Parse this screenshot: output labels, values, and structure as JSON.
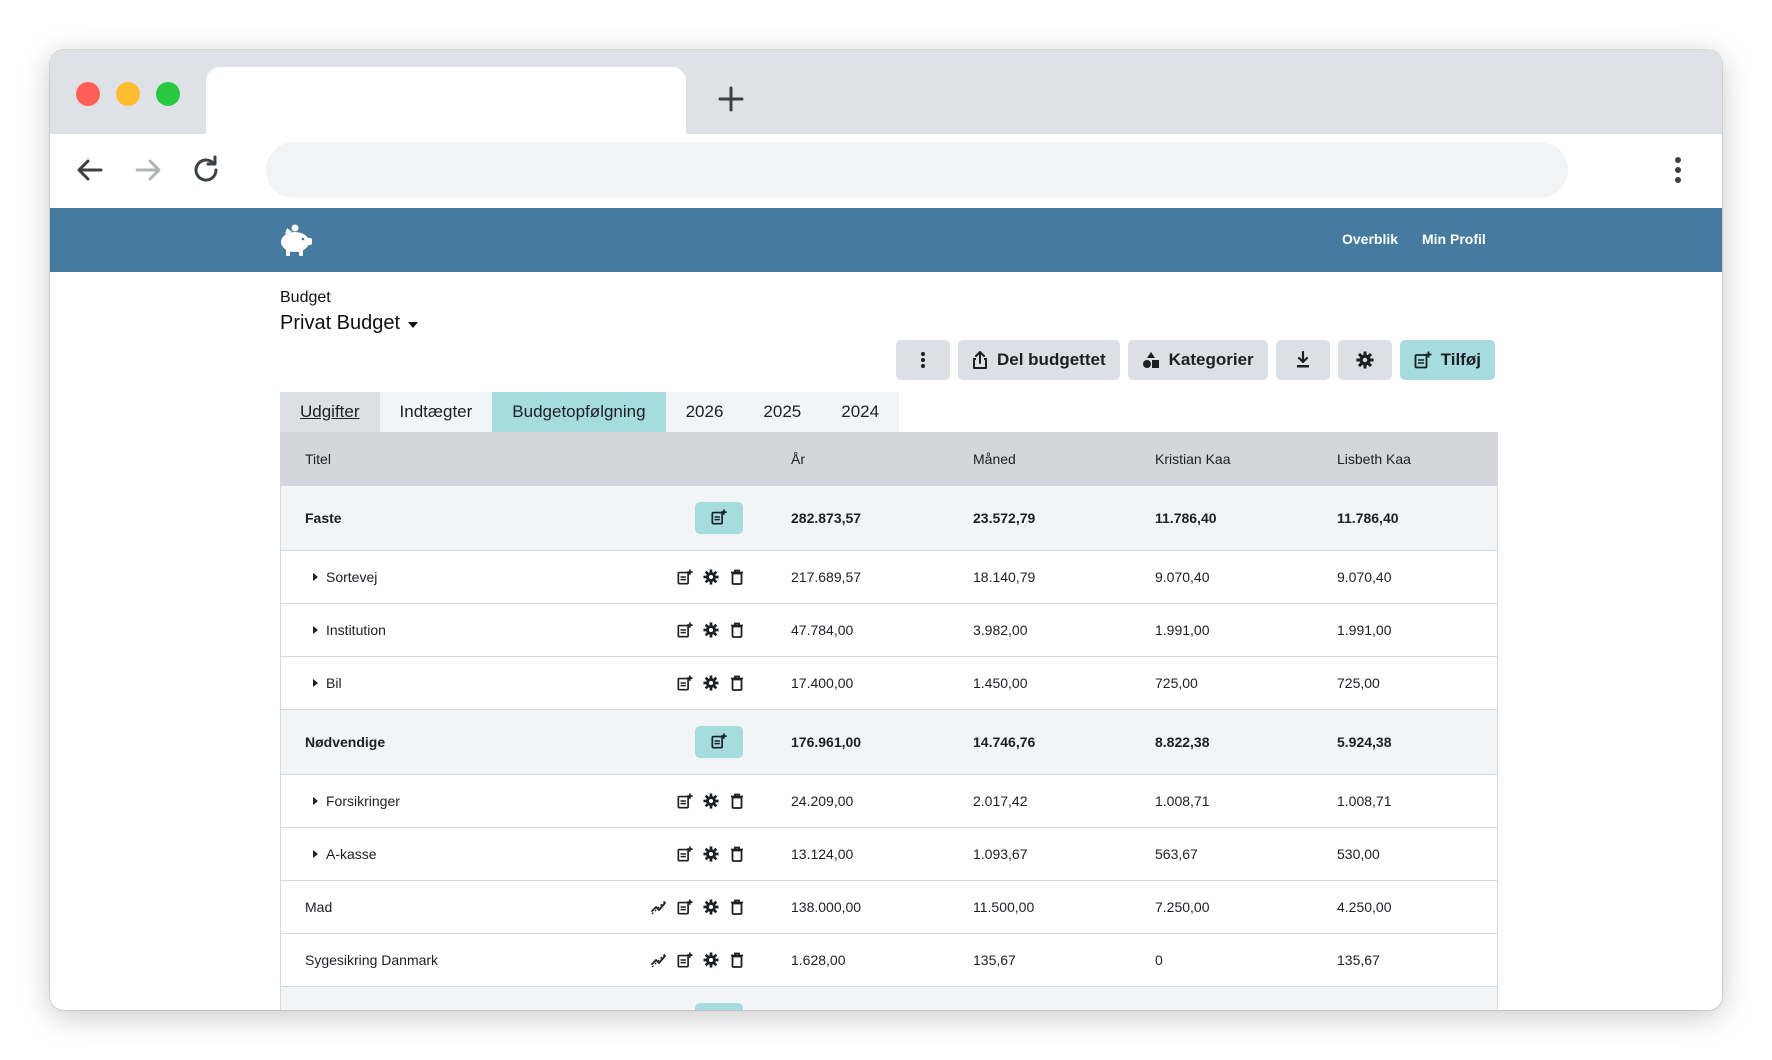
{
  "nav": {
    "links": [
      {
        "label": "Overblik"
      },
      {
        "label": "Min Profil"
      }
    ]
  },
  "budget": {
    "label": "Budget",
    "selected": "Privat Budget"
  },
  "actions": {
    "more": "more-vertical-icon",
    "share_label": "Del budgettet",
    "categories_label": "Kategorier",
    "download": "download-icon",
    "settings": "gear-icon",
    "add_label": "Tilføj"
  },
  "tabs": [
    {
      "label": "Udgifter"
    },
    {
      "label": "Indtægter"
    },
    {
      "label": "Budgetopfølgning"
    },
    {
      "label": "2026"
    },
    {
      "label": "2025"
    },
    {
      "label": "2024"
    }
  ],
  "table": {
    "headers": [
      "Titel",
      "År",
      "Måned",
      "Kristian Kaa",
      "Lisbeth Kaa"
    ],
    "rows": [
      {
        "kind": "group",
        "title": "Faste",
        "ar": "282.873,57",
        "maned": "23.572,79",
        "kristian": "11.786,40",
        "lisbeth": "11.786,40"
      },
      {
        "kind": "sub",
        "title": "Sortevej",
        "ar": "217.689,57",
        "maned": "18.140,79",
        "kristian": "9.070,40",
        "lisbeth": "9.070,40"
      },
      {
        "kind": "sub",
        "title": "Institution",
        "ar": "47.784,00",
        "maned": "3.982,00",
        "kristian": "1.991,00",
        "lisbeth": "1.991,00"
      },
      {
        "kind": "sub",
        "title": "Bil",
        "ar": "17.400,00",
        "maned": "1.450,00",
        "kristian": "725,00",
        "lisbeth": "725,00"
      },
      {
        "kind": "group",
        "title": "Nødvendige",
        "ar": "176.961,00",
        "maned": "14.746,76",
        "kristian": "8.822,38",
        "lisbeth": "5.924,38"
      },
      {
        "kind": "sub",
        "title": "Forsikringer",
        "ar": "24.209,00",
        "maned": "2.017,42",
        "kristian": "1.008,71",
        "lisbeth": "1.008,71"
      },
      {
        "kind": "sub",
        "title": "A-kasse",
        "ar": "13.124,00",
        "maned": "1.093,67",
        "kristian": "563,67",
        "lisbeth": "530,00"
      },
      {
        "kind": "item",
        "title": "Mad",
        "ar": "138.000,00",
        "maned": "11.500,00",
        "kristian": "7.250,00",
        "lisbeth": "4.250,00"
      },
      {
        "kind": "item",
        "title": "Sygesikring Danmark",
        "ar": "1.628,00",
        "maned": "135,67",
        "kristian": "0",
        "lisbeth": "135,67"
      }
    ]
  },
  "colors": {
    "navbar": "#447b9e",
    "accent": "#a6dcde",
    "button": "#dcdfe4",
    "header_row": "#d3d6dc"
  }
}
